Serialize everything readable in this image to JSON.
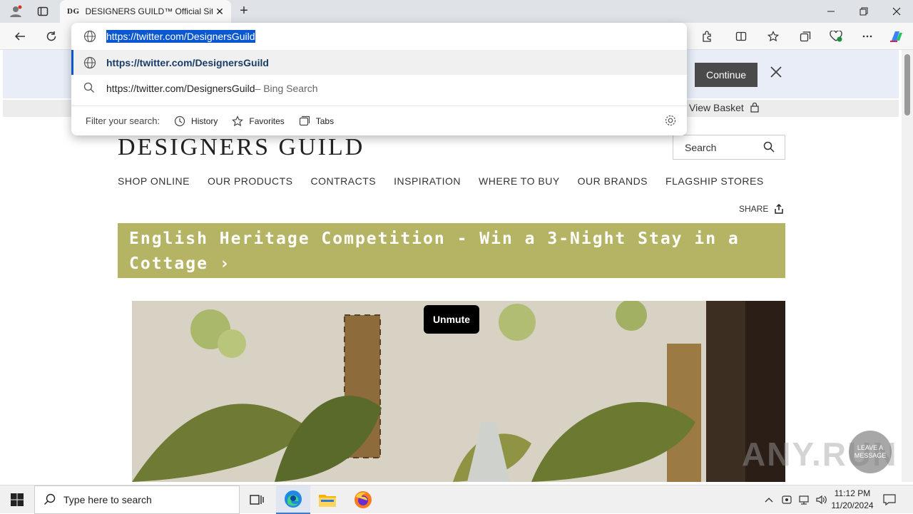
{
  "browser": {
    "tab_favicon": "DG",
    "tab_title": "DESIGNERS GUILD™ Official Site",
    "new_tab_label": "+",
    "window_controls": [
      "minimize",
      "restore",
      "close"
    ]
  },
  "omnibox": {
    "input_value": "https://twitter.com/DesignersGuild",
    "suggestions": [
      {
        "text": "https://twitter.com/DesignersGuild",
        "suffix": "",
        "icon": "globe-icon"
      },
      {
        "text": "https://twitter.com/DesignersGuild",
        "suffix": " – Bing Search",
        "icon": "search-icon"
      }
    ],
    "filter_label": "Filter your search:",
    "filters": [
      "History",
      "Favorites",
      "Tabs"
    ]
  },
  "page": {
    "continue_label": "Continue",
    "basket_label": "View Basket",
    "logo": "DESIGNERS GUILD",
    "search_placeholder": "Search",
    "nav": [
      "SHOP ONLINE",
      "OUR PRODUCTS",
      "CONTRACTS",
      "INSPIRATION",
      "WHERE TO BUY",
      "OUR BRANDS",
      "FLAGSHIP STORES"
    ],
    "share_label": "SHARE",
    "promo_text": "English Heritage Competition - Win a 3-Night Stay in a Cottage ›",
    "unmute_label": "Unmute",
    "colors": {
      "promo": "#b5b464",
      "notice_bar": "#e8edf7"
    }
  },
  "overlay": {
    "watermark": "ANY.RUN",
    "leave_message": "LEAVE A MESSAGE"
  },
  "taskbar": {
    "search_placeholder": "Type here to search",
    "time": "11:12 PM",
    "date": "11/20/2024"
  }
}
